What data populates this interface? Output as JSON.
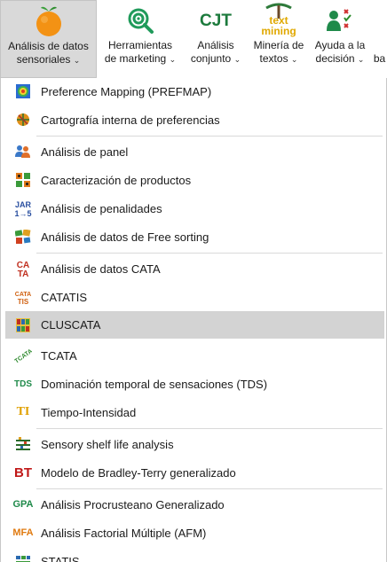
{
  "ribbon": {
    "items": [
      {
        "line1": "Análisis de datos",
        "line2": "sensoriales",
        "icon": "orange-fruit-icon"
      },
      {
        "line1": "Herramientas",
        "line2": "de marketing",
        "icon": "target-magnifier-icon"
      },
      {
        "line1": "Análisis",
        "line2": "conjunto",
        "icon": "cjt-text-icon",
        "icon_text": "CJT"
      },
      {
        "line1": "Minería de",
        "line2": "textos",
        "icon": "text-mining-icon",
        "icon_text_top": "text",
        "icon_text_bottom": "mining"
      },
      {
        "line1": "Ayuda a la",
        "line2": "decisión",
        "icon": "decision-icon"
      },
      {
        "line1": "",
        "line2": "ba",
        "icon": ""
      }
    ]
  },
  "menu": {
    "items": [
      {
        "label": "Preference Mapping (PREFMAP)",
        "icon": "prefmap-icon"
      },
      {
        "label": "Cartografía interna de preferencias",
        "icon": "internal-map-icon"
      },
      {
        "label": "Análisis de panel",
        "icon": "panel-people-icon"
      },
      {
        "label": "Caracterización de productos",
        "icon": "product-grid-icon"
      },
      {
        "label": "Análisis de penalidades",
        "icon": "jar-icon",
        "icon_text_top": "JAR",
        "icon_text_bottom": "1→5"
      },
      {
        "label": "Análisis de datos de Free sorting",
        "icon": "free-sorting-icon"
      },
      {
        "label": "Análisis de datos CATA",
        "icon": "cata-icon",
        "icon_text_top": "CA",
        "icon_text_bottom": "TA"
      },
      {
        "label": "CATATIS",
        "icon": "catatis-icon",
        "icon_text_top": "CATA",
        "icon_text_bottom": "TIS"
      },
      {
        "label": "CLUSCATA",
        "icon": "cluscata-icon"
      },
      {
        "label": "TCATA",
        "icon": "tcata-icon",
        "icon_text": "TCATA"
      },
      {
        "label": "Dominación temporal de sensaciones (TDS)",
        "icon": "tds-icon",
        "icon_text": "TDS"
      },
      {
        "label": "Tiempo-Intensidad",
        "icon": "ti-icon",
        "icon_text": "TI"
      },
      {
        "label": "Sensory shelf life analysis",
        "icon": "shelf-life-icon"
      },
      {
        "label": "Modelo de Bradley-Terry generalizado",
        "icon": "bt-icon",
        "icon_text": "BT"
      },
      {
        "label": "Análisis Procrusteano Generalizado",
        "icon": "gpa-icon",
        "icon_text": "GPA"
      },
      {
        "label": "Análisis Factorial Múltiple (AFM)",
        "icon": "mfa-icon",
        "icon_text": "MFA"
      },
      {
        "label": "STATIS",
        "icon": "statis-icon"
      }
    ]
  },
  "colors": {
    "highlight": "#d3d3d3",
    "active_tab": "#d9d9d9",
    "separator": "#d9d9d9"
  }
}
